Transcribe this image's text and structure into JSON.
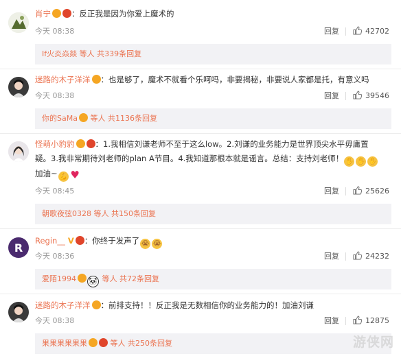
{
  "comments": [
    {
      "user": "肖宁",
      "text": "：反正我是因为你爱上魔术的",
      "time": "今天 08:38",
      "reply": "回复",
      "likes": "42702",
      "sub": {
        "name": "If火炎焱燚",
        "rest": " 等人 共339条回复"
      }
    },
    {
      "user": "迷路的木子洋洋",
      "text": "：也是够了，魔术不就看个乐呵吗，非要揭秘，非要说人家都是托，有意义吗",
      "time": "今天 08:38",
      "reply": "回复",
      "likes": "39546",
      "sub": {
        "name": "你的SaMa",
        "rest": " 等人 共1136条回复"
      }
    },
    {
      "user": "怪萌小豹豹",
      "text1": "：1.我相信刘谦老师不至于这么low。2.刘谦的业务能力是世界顶尖水平毋庸置",
      "text2": "疑。3.我非常期待刘老师的plan A节目。4.我知道那根本就是谣言。总结：支持刘老师！",
      "text3": "加油~",
      "time": "今天 08:45",
      "reply": "回复",
      "likes": "25626",
      "sub": {
        "name": "朝歌夜弦0328",
        "rest": " 等人 共150条回复"
      }
    },
    {
      "user": "Regin__",
      "text": "：你终于发声了",
      "time": "今天 08:36",
      "reply": "回复",
      "likes": "24232",
      "sub": {
        "name": "爱陌1994",
        "rest": " 等人 共72条回复"
      }
    },
    {
      "user": "迷路的木子洋洋",
      "text": "：前排支持！！反正我是无数相信你的业务能力的！加油刘谦",
      "time": "今天 08:38",
      "reply": "回复",
      "likes": "12875",
      "sub": {
        "name": "果果果果果果",
        "rest": " 等人 共250条回复"
      }
    }
  ],
  "watermark": "游侠网",
  "colors": {
    "username": "#eb7350",
    "meta": "#999999",
    "subreply_bg": "#f2f2f5"
  }
}
